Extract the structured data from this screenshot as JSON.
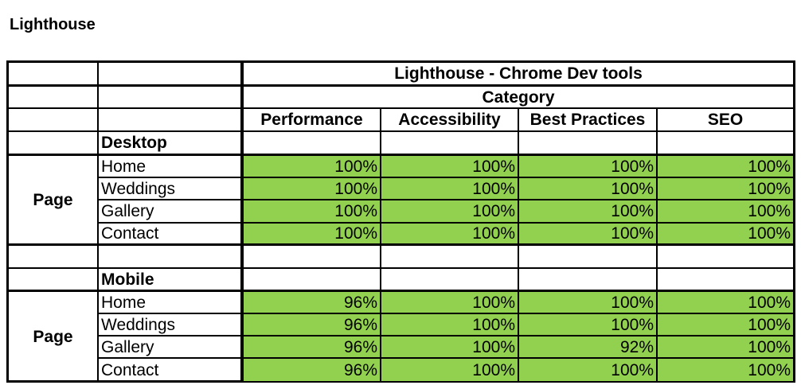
{
  "page_title": "Lighthouse",
  "table": {
    "title": "Lighthouse - Chrome Dev tools",
    "subtitle": "Category",
    "columns": [
      "Performance",
      "Accessibility",
      "Best Practices",
      "SEO"
    ],
    "highlight_color": "#92d050",
    "sections": [
      {
        "name": "Desktop",
        "group_label": "Page",
        "rows": [
          {
            "label": "Home",
            "values": [
              "100%",
              "100%",
              "100%",
              "100%"
            ]
          },
          {
            "label": "Weddings",
            "values": [
              "100%",
              "100%",
              "100%",
              "100%"
            ]
          },
          {
            "label": "Gallery",
            "values": [
              "100%",
              "100%",
              "100%",
              "100%"
            ]
          },
          {
            "label": "Contact",
            "values": [
              "100%",
              "100%",
              "100%",
              "100%"
            ]
          }
        ]
      },
      {
        "name": "Mobile",
        "group_label": "Page",
        "rows": [
          {
            "label": "Home",
            "values": [
              "96%",
              "100%",
              "100%",
              "100%"
            ]
          },
          {
            "label": "Weddings",
            "values": [
              "96%",
              "100%",
              "100%",
              "100%"
            ]
          },
          {
            "label": "Gallery",
            "values": [
              "96%",
              "100%",
              "92%",
              "100%"
            ]
          },
          {
            "label": "Contact",
            "values": [
              "96%",
              "100%",
              "100%",
              "100%"
            ]
          }
        ]
      }
    ]
  }
}
